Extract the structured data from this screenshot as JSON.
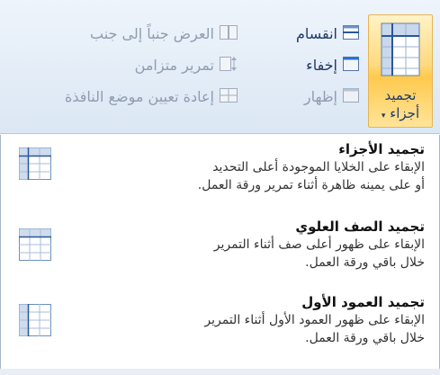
{
  "ribbon": {
    "freeze_button": {
      "label_line1": "تجميد",
      "label_line2": "أجزاء",
      "arrow": "▾"
    },
    "split": "انقسام",
    "hide": "إخفاء",
    "unhide": "إظهار",
    "view_side_by_side": "العرض جنباً إلى جنب",
    "sync_scroll": "تمرير متزامن",
    "reset_position": "إعادة تعيين موضع النافذة"
  },
  "menu": {
    "items": [
      {
        "title": "تجميد الأجزاء",
        "desc_line1": "الإبقاء على الخلايا الموجودة أعلى التحديد",
        "desc_line2": "أو على يمينه ظاهرة أثناء تمرير ورقة العمل.",
        "icon": "freeze-panes-icon"
      },
      {
        "title": "تجميد الصف العلوي",
        "desc_line1": "الإبقاء على ظهور أعلى صف أثناء التمرير",
        "desc_line2": "خلال باقي ورقة العمل.",
        "icon": "freeze-top-row-icon"
      },
      {
        "title": "تجميد العمود الأول",
        "desc_line1": "الإبقاء على ظهور العمود الأول أثناء التمرير",
        "desc_line2": "خلال باقي ورقة العمل.",
        "icon": "freeze-first-column-icon"
      }
    ]
  },
  "colors": {
    "accent_border": "#e6b450",
    "ribbon_bg": "#dbe7f4",
    "text_dark": "#1f3a67"
  }
}
